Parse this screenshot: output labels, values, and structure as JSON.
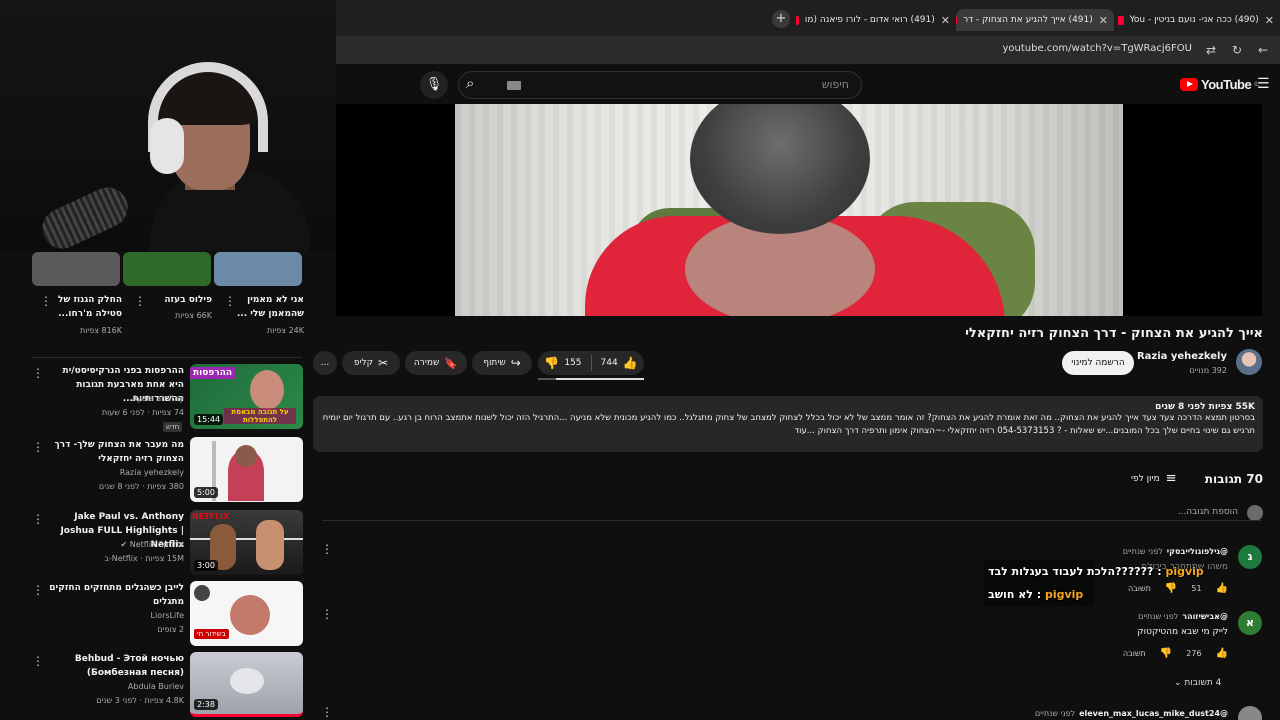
{
  "browser": {
    "tabs": [
      {
        "label": "(490) ככה אני- נועם בניטין - You"
      },
      {
        "label": "(491) אייך להגיע את הצחוק - דר"
      },
      {
        "label": "(491) רואי אדום - לורו פיאנה (מו"
      }
    ],
    "url": "youtube.com/watch?v=TgWRacj6FOU"
  },
  "header": {
    "logo": "YouTube",
    "logo_region": "IL",
    "search_placeholder": "חיפוש"
  },
  "video": {
    "title": "אייך להגיע את הצחוק - דרך הצחוק רזיה יחזקאלי",
    "channel": "Razia yehezkely",
    "subscribers": "392 מנויים",
    "subscribe_label": "הרשמה למינוי",
    "likes": "744",
    "like_ratio": 0.83,
    "dislikes": "155",
    "share_label": "שיתוף",
    "save_label": "שמירה",
    "clip_label": "קליפ",
    "more": "..."
  },
  "description": {
    "meta": "55K צפיות  לפני 8 שנים",
    "line1": "בסרטון תמצא הדרכה צעד צעד אייך להגיע את הצחוק.. מה זאת אומרת להגיע את הצחוק?  זה אומר ממצב של לא יכול בכלל לצחוק למצחב של צחוק מתגלגל.. כמו להגיע מכונית שלא מניעה ...התרגיל הזה יכול לשנות אתמצב הרוח בן רגע.. עם תרגול יום יומיח",
    "line2": "תרגיש גם שינוי בחיים שלך בכל המובנים...יש שאלות - ? 054-5373153 רזיה יחזקאלי -~הצחוק אימון ותרפיה דרך הצחוק    ...עוד"
  },
  "comments": {
    "count": "70 תגובות",
    "sort_label": "מיון לפי",
    "add_placeholder": "הוספת תגובה...",
    "reply_label": "תשובה",
    "items": [
      {
        "avatar": "ג",
        "avatar_color": "#1e7a3c",
        "user": "@גילפוגולייבסקי",
        "time": "לפני שנתיים",
        "text": "משהו שמתחבר ביכולת... ",
        "likes": "51"
      },
      {
        "avatar": "א",
        "avatar_color": "#2e7d32",
        "user": "@אבישיזוהר",
        "time": "לפני שנתיים",
        "text": "לייק מי שבא מהטיקטוק",
        "likes": "276",
        "replies": "4 תשובות"
      },
      {
        "user": "@eleven_max_lucas_mike_dust24",
        "time": "לפני שנתיים"
      }
    ]
  },
  "overlay_chat": [
    {
      "user": "pigvip",
      "text": "??????הלכת לעבוד בעגלות לבד"
    },
    {
      "user": "pigvip",
      "text": "לא חושב"
    }
  ],
  "sidebar": {
    "shorts": [
      {
        "title": "החלק הגנוז של סטילה מ'רחו...",
        "views": "816K צפיות"
      },
      {
        "title": "פילוס בעזה",
        "views": "66K צפיות"
      },
      {
        "title": "אני לא מאמין שהמאמן שלי ...",
        "views": "24K צפיות"
      }
    ],
    "videos": [
      {
        "title": "ההרפסות בפני הנרקיסיסט/ית היא אחת מארבעת תגובות ההשרדותיות...",
        "channel": "Ayala amitay",
        "meta": "74 צפיות · לפני 6 שעות",
        "badge": "חדש",
        "duration": "15:44",
        "thumb_text": "ההרפסות",
        "thumb_sub": "על תגובה מבאסת להתפללות"
      },
      {
        "title": "מה מעבר את הצחוק שלך- דרך הצחוק רזיה יחזקאלי",
        "channel": "Razia yehezkely",
        "meta": "380 צפיות · לפני 8 שנים",
        "duration": "5:00"
      },
      {
        "title": "Jake Paul vs. Anthony Joshua FULL Highlights | Netflix",
        "channel": "Netflix Sports",
        "meta": "15M צפיות · Netflix-ב",
        "duration": "3:00",
        "thumb_text": "NETFLIX"
      },
      {
        "title": "לייבן כשהגלים מתחזקים החזקים מתגלים",
        "channel": "LiorsLife",
        "meta": "2 צופים",
        "thumb_text": "בשידור חי"
      },
      {
        "title": "Behbud - Этой ночью (Бомбезная песня)",
        "channel": "Abdula Buriev",
        "meta": "4.8K צפיות · לפני 3 שנים",
        "duration": "2:38"
      }
    ]
  }
}
